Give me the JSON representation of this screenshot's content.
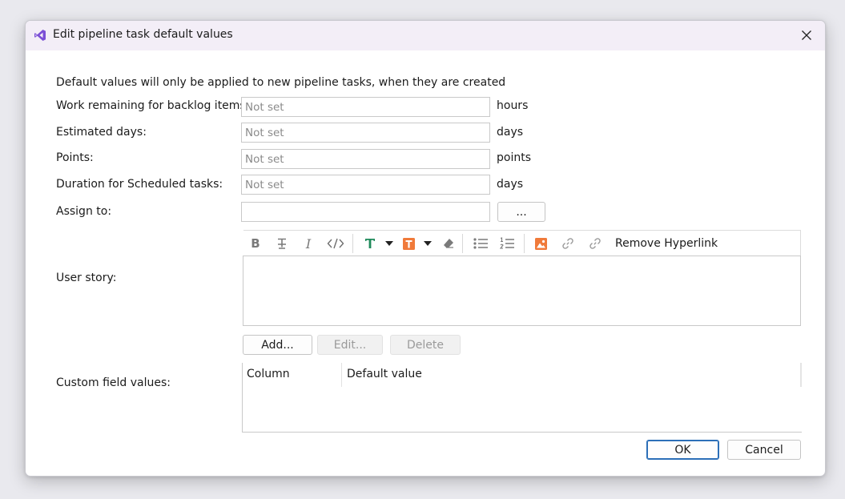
{
  "dialog": {
    "title": "Edit pipeline task default values",
    "close_icon": "close-icon",
    "app_icon": "visual-studio-icon"
  },
  "intro_text": "Default values will only be applied to new pipeline tasks, when they are created",
  "fields": [
    {
      "label": "Work remaining for backlog items:",
      "value": "",
      "placeholder": "Not set",
      "unit": "hours"
    },
    {
      "label": "Estimated days:",
      "value": "",
      "placeholder": "Not set",
      "unit": "days"
    },
    {
      "label": "Points:",
      "value": "",
      "placeholder": "Not set",
      "unit": "points"
    },
    {
      "label": "Duration for Scheduled tasks:",
      "value": "",
      "placeholder": "Not set",
      "unit": "days"
    }
  ],
  "assign_to": {
    "label": "Assign to:",
    "value": "",
    "browse_label": "..."
  },
  "user_story": {
    "label": "User story:",
    "toolbar": {
      "icons": [
        "bold-icon",
        "strikethrough-icon",
        "italic-icon",
        "code-icon",
        "text-color-icon",
        "chevron-down-icon",
        "highlight-color-icon",
        "chevron-down-icon",
        "eraser-icon",
        "bullet-list-icon",
        "numbered-list-icon",
        "image-icon",
        "link-icon",
        "unlink-icon"
      ],
      "text_color": "#1f8a5b",
      "highlight_color": "#f07a3a",
      "remove_hyperlink_label": "Remove Hyperlink"
    },
    "value": ""
  },
  "custom_fields": {
    "label": "Custom field values:",
    "buttons": {
      "add": "Add...",
      "edit": "Edit...",
      "delete": "Delete"
    },
    "columns": [
      "Column",
      "Default value"
    ],
    "rows": []
  },
  "footer": {
    "ok": "OK",
    "cancel": "Cancel"
  },
  "colors": {
    "accent": "#2c6fb8",
    "titlebar": "#f3eef7",
    "icon_purple": "#7b4fd6"
  }
}
